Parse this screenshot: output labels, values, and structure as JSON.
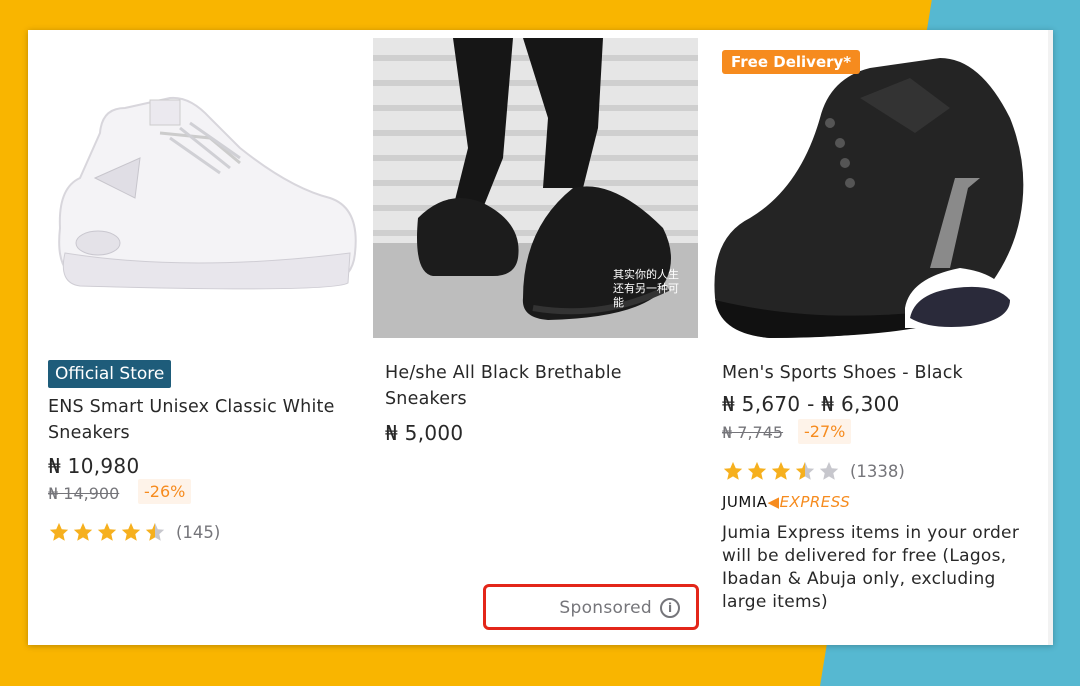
{
  "products": [
    {
      "badge": "Official Store",
      "name_line1": "ENS Smart Unisex Classic White",
      "name_line2": "Sneakers",
      "price": "₦ 10,980",
      "old_price": "₦ 14,900",
      "discount": "-26%",
      "rating": 4.5,
      "reviews": "(145)"
    },
    {
      "name_line1": "He/she All Black Brethable",
      "name_line2": "Sneakers",
      "price": "₦ 5,000",
      "img_text": "其实你的人生还有另一种可能"
    },
    {
      "promo_badge": "Free Delivery*",
      "name_line1": "Men's Sports Shoes - Black",
      "price": "₦ 5,670 - ₦ 6,300",
      "old_price": "₦ 7,745",
      "discount": "-27%",
      "rating": 3.5,
      "reviews": "(1338)",
      "brand_jumia": "JUMIA",
      "brand_express": "EXPRESS",
      "note": "Jumia Express items in your order will be delivered for free (Lagos, Ibadan & Abuja only, excluding large items)"
    }
  ],
  "sponsored": {
    "label": "Sponsored",
    "icon": "info-icon"
  },
  "colors": {
    "accent": "#f68b1e",
    "store_badge": "#1e5c7a",
    "highlight": "#e32619",
    "star": "#f6b01e",
    "star_empty": "#c7c7cd"
  }
}
